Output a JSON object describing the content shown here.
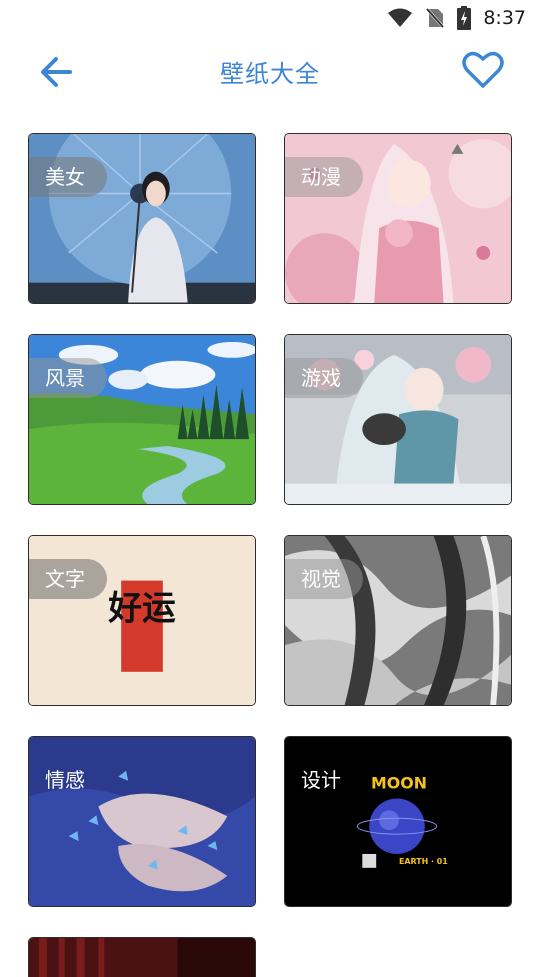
{
  "status": {
    "time": "8:37"
  },
  "header": {
    "title": "壁纸大全"
  },
  "categories": [
    {
      "label": "美女"
    },
    {
      "label": "动漫"
    },
    {
      "label": "风景"
    },
    {
      "label": "游戏"
    },
    {
      "label": "文字"
    },
    {
      "label": "视觉"
    },
    {
      "label": "情感"
    },
    {
      "label": "设计"
    }
  ],
  "art_text": {
    "lucky": "好运",
    "moon": "MOON",
    "earth": "EARTH · 01"
  },
  "colors": {
    "accent": "#3d86d6"
  }
}
